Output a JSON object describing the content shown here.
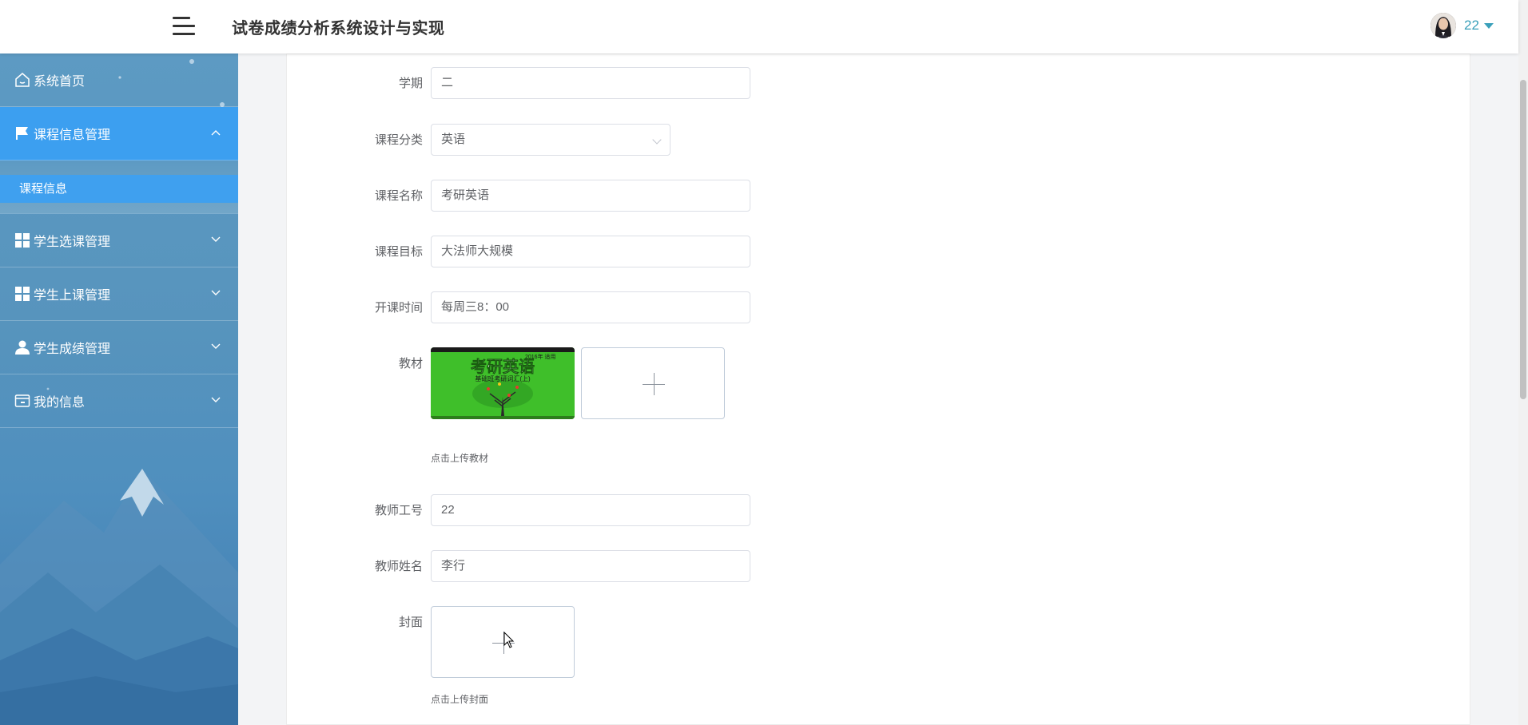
{
  "header": {
    "title": "试卷成绩分析系统设计与实现",
    "username": "22"
  },
  "sidebar": {
    "items": [
      {
        "label": "系统首页",
        "icon": "home-icon",
        "expandable": false
      },
      {
        "label": "课程信息管理",
        "icon": "flag-icon",
        "expandable": true,
        "expanded": true,
        "active": true
      },
      {
        "label": "学生选课管理",
        "icon": "grid-icon",
        "expandable": true
      },
      {
        "label": "学生上课管理",
        "icon": "grid-icon",
        "expandable": true
      },
      {
        "label": "学生成绩管理",
        "icon": "user-icon",
        "expandable": true
      },
      {
        "label": "我的信息",
        "icon": "wallet-icon",
        "expandable": true
      }
    ],
    "submenu": {
      "label": "课程信息"
    }
  },
  "form": {
    "semester": {
      "label": "学期",
      "value": "二"
    },
    "category": {
      "label": "课程分类",
      "value": "英语"
    },
    "course_name": {
      "label": "课程名称",
      "value": "考研英语"
    },
    "course_goal": {
      "label": "课程目标",
      "value": "大法师大规模"
    },
    "schedule": {
      "label": "开课时间",
      "value": "每周三8：00"
    },
    "textbook": {
      "label": "教材",
      "tip": "点击上传教材",
      "thumb_texts": [
        "2016年 适用",
        "考研英语",
        "基础班考研词汇(上)"
      ]
    },
    "teacher_id": {
      "label": "教师工号",
      "value": "22"
    },
    "teacher_name": {
      "label": "教师姓名",
      "value": "李行"
    },
    "cover": {
      "label": "封面",
      "tip": "点击上传封面"
    }
  },
  "colors": {
    "accent": "#3aa0ba",
    "sidebar_active": "#3c9ff0",
    "sidebar_bg": "#5794bd"
  }
}
